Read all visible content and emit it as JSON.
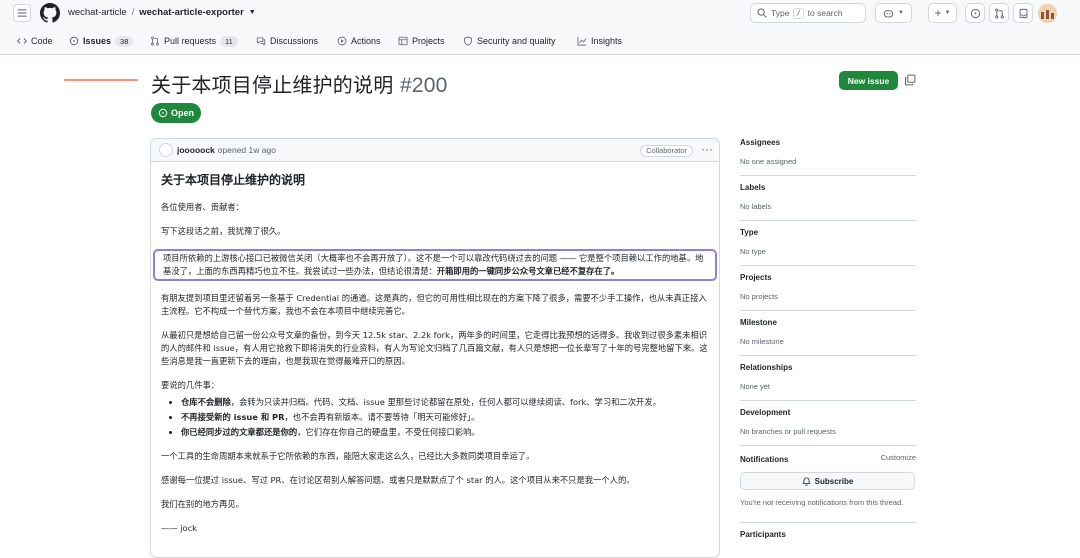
{
  "header": {
    "owner": "wechat-article",
    "separator": "/",
    "repo": "wechat-article-exporter",
    "search_placeholder_prefix": "Type",
    "search_slash": "/",
    "search_placeholder_suffix": "to search"
  },
  "nav": {
    "tabs": [
      {
        "label": "Code",
        "icon": "code-icon"
      },
      {
        "label": "Issues",
        "count": "38",
        "icon": "issue-icon"
      },
      {
        "label": "Pull requests",
        "count": "11",
        "icon": "pull-request-icon"
      },
      {
        "label": "Discussions",
        "icon": "discussion-icon"
      },
      {
        "label": "Actions",
        "icon": "play-icon"
      },
      {
        "label": "Projects",
        "icon": "table-icon"
      },
      {
        "label": "Security and quality",
        "icon": "shield-icon"
      },
      {
        "label": "Insights",
        "icon": "graph-icon"
      }
    ]
  },
  "issue": {
    "title": "关于本项目停止维护的说明",
    "number": "#200",
    "state": "Open",
    "new_issue_label": "New issue"
  },
  "comment": {
    "author": "jooooock",
    "meta": "opened 1w ago",
    "role": "Collaborator",
    "heading": "关于本项目停止维护的说明",
    "p1": "各位使用者、贡献者：",
    "p2": "写下这段话之前，我犹豫了很久。",
    "p3_normal": "项目所依赖的上游核心接口已被微信关闭（大概率也不会再开放了）。这不是一个可以靠改代码绕过去的问题 —— 它是整个项目赖以工作的地基。地基没了，上面的东西再精巧也立不住。我尝试过一些办法，但结论很清楚：",
    "p3_bold": "开箱即用的一键同步公众号文章已经不复存在了。",
    "p4": "有朋友提到项目里还留着另一条基于 Credential 的通道。这是真的，但它的可用性相比现在的方案下降了很多，需要不少手工操作，也从未真正接入主流程。它不构成一个替代方案，我也不会在本项目中继续完善它。",
    "p5": "从最初只是想给自己留一份公众号文章的备份，到今天 12.5k star、2.2k fork，两年多的时间里，它走得比我预想的远得多。我收到过很多素未相识的人的邮件和 issue，有人用它抢救下即将消失的行业资料，有人为写论文归档了几百篇文献，有人只是想把一位长辈写了十年的号完整地留下来。这些消息是我一直更新下去的理由，也是我现在觉得最难开口的原因。",
    "p6": "要说的几件事：",
    "bullets": [
      {
        "bold": "仓库不会删除",
        "text": "，会转为只读并归档。代码、文档、issue 里那些讨论都留在原处，任何人都可以继续阅读、fork、学习和二次开发。"
      },
      {
        "bold": "不再接受新的 issue 和 PR",
        "text": "，也不会再有新版本。请不要等待「明天可能修好」。"
      },
      {
        "bold": "你已经同步过的文章都还是你的",
        "text": "，它们存在你自己的硬盘里，不受任何接口影响。"
      }
    ],
    "p7": "一个工具的生命周期本来就系于它所依赖的东西，能陪大家走这么久，已经比大多数同类项目幸运了。",
    "p8": "感谢每一位提过 issue、写过 PR、在讨论区帮别人解答问题、或者只是默默点了个 star 的人。这个项目从来不只是我一个人的。",
    "p9": "我们在别的地方再见。",
    "signature": "—— jock"
  },
  "sidebar": {
    "assignees_title": "Assignees",
    "assignees_value": "No one assigned",
    "labels_title": "Labels",
    "labels_value": "No labels",
    "type_title": "Type",
    "type_value": "No type",
    "projects_title": "Projects",
    "projects_value": "No projects",
    "milestone_title": "Milestone",
    "milestone_value": "No milestone",
    "relationships_title": "Relationships",
    "relationships_value": "None yet",
    "development_title": "Development",
    "development_value": "No branches or pull requests",
    "notifications_title": "Notifications",
    "customize_label": "Customize",
    "subscribe_label": "Subscribe",
    "notify_text": "You're not receiving notifications from this thread.",
    "participants_title": "Participants"
  },
  "colors": {
    "accent_green": "#1f883d",
    "tab_underline": "#fd8c73",
    "highlight_border": "#8b7fe0"
  }
}
